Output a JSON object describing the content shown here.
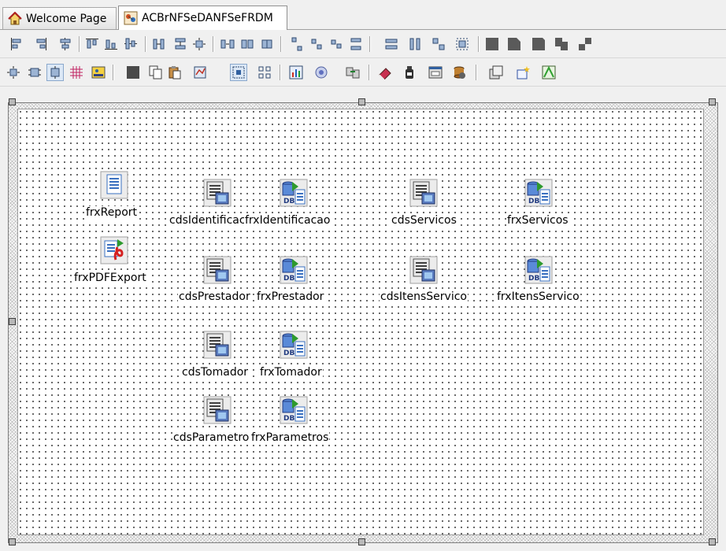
{
  "tabs": [
    {
      "label": "Welcome Page",
      "icon": "home-icon",
      "active": false
    },
    {
      "label": "ACBrNFSeDANFSeFRDM",
      "icon": "data-module-icon",
      "active": true
    }
  ],
  "designer": {
    "components": [
      {
        "name": "frxReport",
        "type": "report"
      },
      {
        "name": "frxPDFExport",
        "type": "pdf-export"
      },
      {
        "name": "cdsIdentificac",
        "type": "client-dataset"
      },
      {
        "name": "frxIdentificacao",
        "type": "db-dataset"
      },
      {
        "name": "cdsServicos",
        "type": "client-dataset"
      },
      {
        "name": "frxServicos",
        "type": "db-dataset"
      },
      {
        "name": "cdsPrestador",
        "type": "client-dataset"
      },
      {
        "name": "frxPrestador",
        "type": "db-dataset"
      },
      {
        "name": "cdsItensServico",
        "type": "client-dataset"
      },
      {
        "name": "frxItensServico",
        "type": "db-dataset"
      },
      {
        "name": "cdsTomador",
        "type": "client-dataset"
      },
      {
        "name": "frxTomador",
        "type": "db-dataset"
      },
      {
        "name": "cdsParametro",
        "type": "client-dataset"
      },
      {
        "name": "frxParametros",
        "type": "db-dataset"
      }
    ]
  },
  "colors": {
    "accent": "#3b74c4",
    "pdf_red": "#d42020",
    "db_green": "#2e9a2e"
  }
}
